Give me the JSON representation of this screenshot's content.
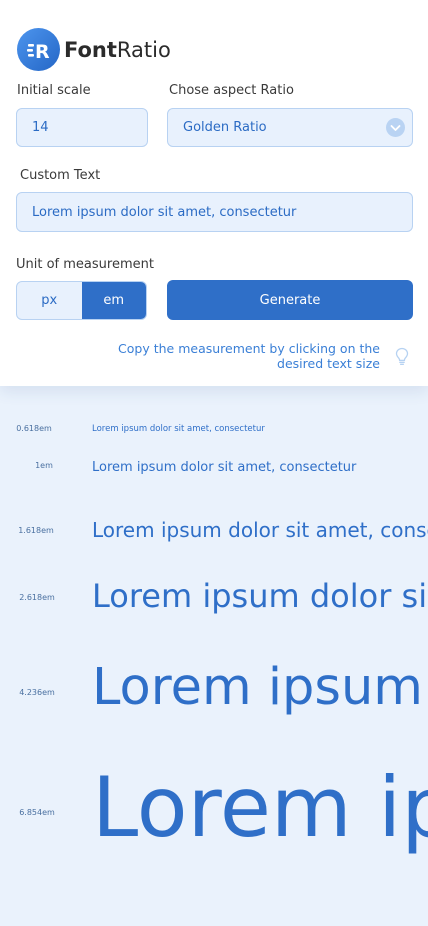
{
  "brand": {
    "name_bold": "Font",
    "name_regular": "Ratio",
    "badge_letter": "R"
  },
  "form": {
    "initial_scale_label": "Initial scale",
    "initial_scale_value": "14",
    "aspect_label": "Chose aspect Ratio",
    "aspect_value": "Golden Ratio",
    "custom_text_label": "Custom Text",
    "custom_text_value": "Lorem ipsum dolor sit amet, consectetur",
    "unit_label": "Unit of measurement",
    "unit_options": [
      "px",
      "em"
    ],
    "unit_selected": "em",
    "generate_label": "Generate",
    "hint": "Copy the measurement by clicking on the desired text size"
  },
  "scale_rows": [
    {
      "label": "0.618em",
      "text": "Lorem ipsum dolor sit amet, consectetur"
    },
    {
      "label": "1em",
      "text": "Lorem ipsum dolor sit amet, consectetur"
    },
    {
      "label": "1.618em",
      "text": "Lorem ipsum dolor sit amet, consectetur"
    },
    {
      "label": "2.618em",
      "text": "Lorem ipsum dolor sit amet, consectetur"
    },
    {
      "label": "4.236em",
      "text": "Lorem ipsum dolor sit amet, consectetur"
    },
    {
      "label": "6.854em",
      "text": "Lorem ipsum dolor sit amet, consectetur"
    }
  ],
  "colors": {
    "accent": "#2f6fc8",
    "field_bg": "#e8f1fd",
    "page_bg": "#eaf2fc"
  }
}
